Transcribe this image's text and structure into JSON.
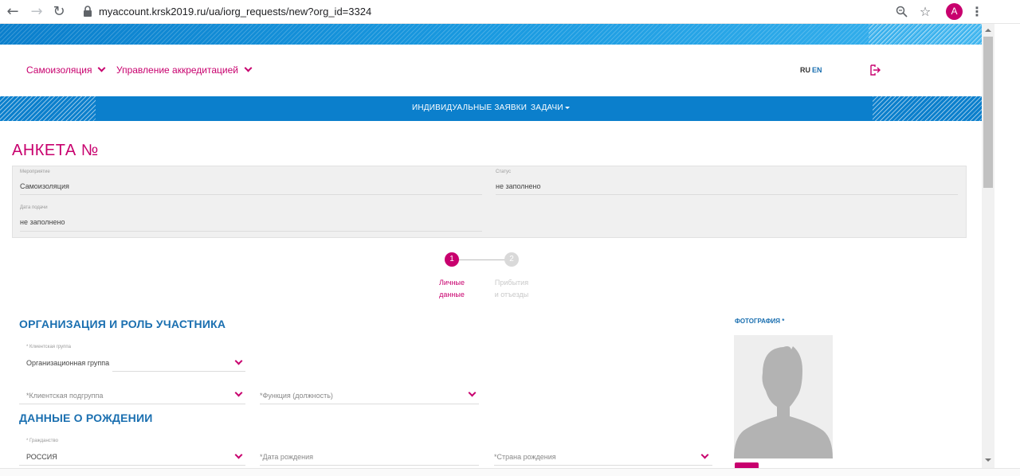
{
  "browser": {
    "url": "myaccount.krsk2019.ru/ua/iorg_requests/new?org_id=3324",
    "avatar_letter": "A"
  },
  "header": {
    "menu": [
      {
        "label": "Самоизоляция"
      },
      {
        "label": "Управление аккредитацией"
      }
    ],
    "lang_ru": "RU",
    "lang_en": "EN"
  },
  "nav": {
    "individual": "ИНДИВИДУАЛЬНЫЕ ЗАЯВКИ",
    "tasks": "ЗАДАЧИ"
  },
  "page": {
    "title": "АНКЕТА №"
  },
  "info": {
    "event_label": "Мероприятие",
    "event_value": "Самоизоляция",
    "status_label": "Статус",
    "status_value": "не заполнено",
    "date_label": "Дата подачи",
    "date_value": "не заполнено"
  },
  "stepper": {
    "step1_num": "1",
    "step1_line1": "Личные",
    "step1_line2": "данные",
    "step2_num": "2",
    "step2_line1": "Прибытия",
    "step2_line2": "и отъезды"
  },
  "section_org": {
    "title": "ОРГАНИЗАЦИЯ И РОЛЬ УЧАСТНИКА",
    "client_group_label": "* Клиентская группа",
    "client_group_value": "Организационная группа",
    "client_subgroup_placeholder": "*Клиентская подгруппа",
    "function_placeholder": "*Функция (должность)"
  },
  "section_birth": {
    "title": "ДАННЫЕ О РОЖДЕНИИ",
    "citizenship_label": "* Гражданство",
    "citizenship_value": "РОССИЯ",
    "birth_date_placeholder": "*Дата рождения",
    "birth_country_placeholder": "*Страна рождения"
  },
  "photo": {
    "title": "ФОТОГРАФИЯ *"
  },
  "colors": {
    "accent": "#c8006e",
    "blue": "#0b7fcc",
    "section_blue": "#1a6fb0"
  }
}
